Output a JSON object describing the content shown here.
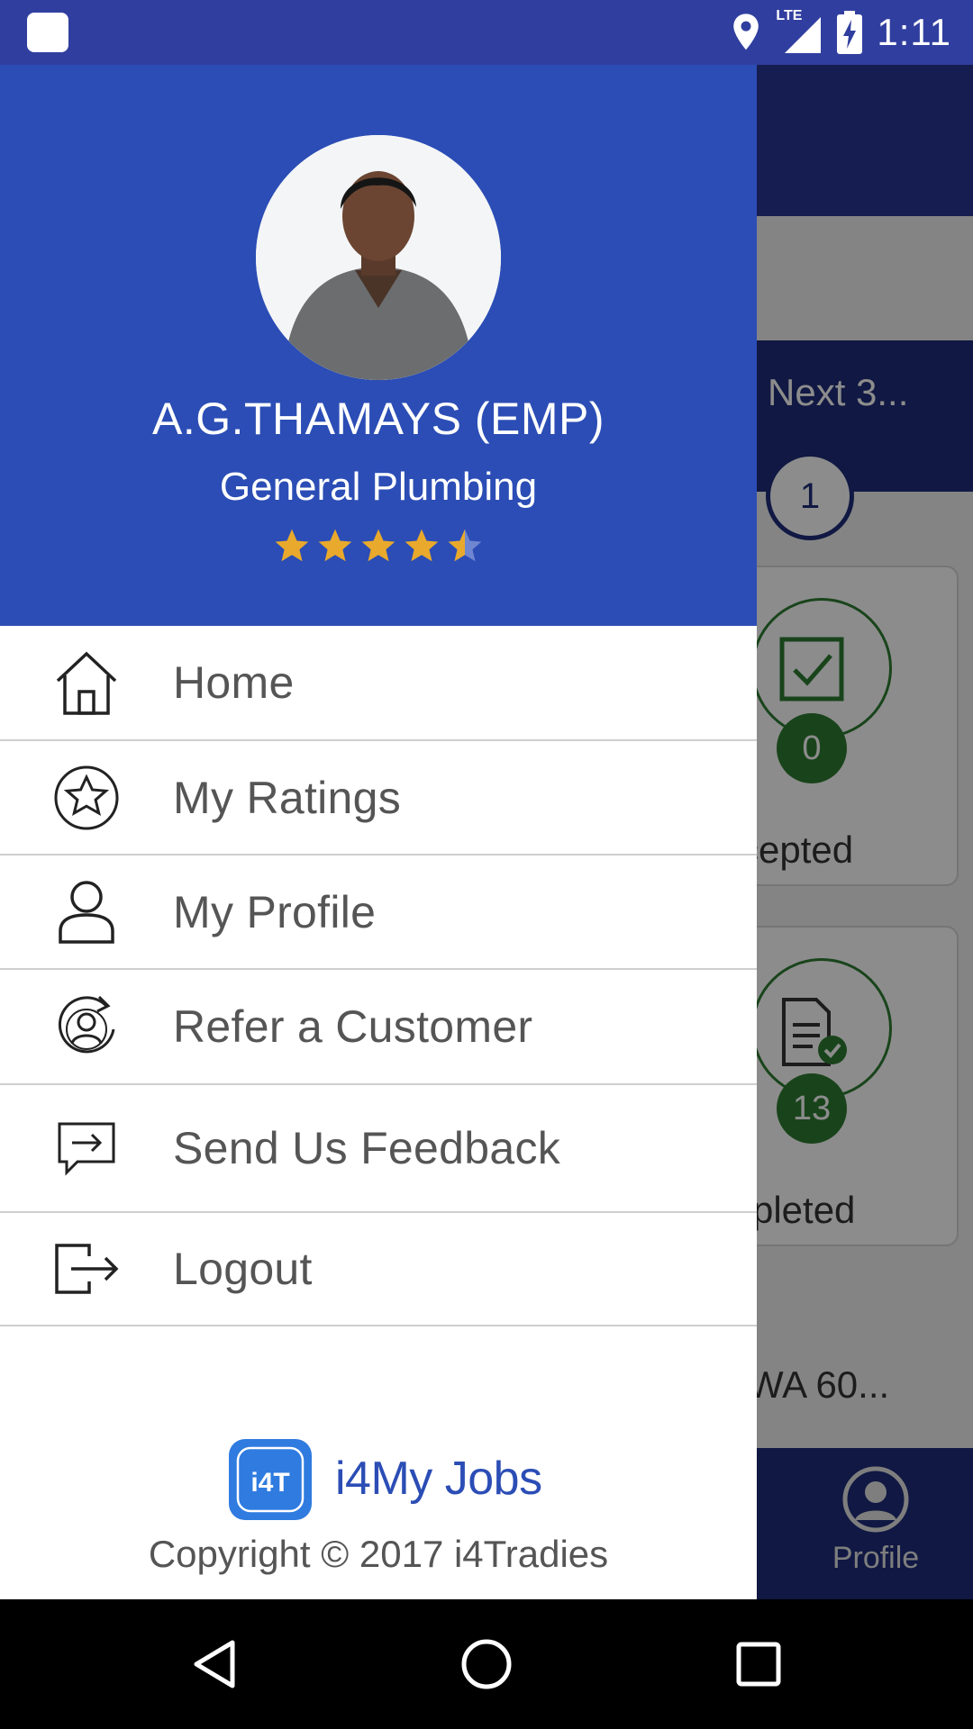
{
  "status_bar": {
    "time": "1:11",
    "network": "LTE"
  },
  "background_screen": {
    "band_text": "Next 3...",
    "step_number": "1",
    "cards": [
      {
        "count": "0",
        "label": "ccepted"
      },
      {
        "count": "13",
        "label": "mpleted"
      }
    ],
    "address_text": "WA 60...",
    "bottom_nav_profile_label": "Profile"
  },
  "drawer": {
    "header": {
      "name": "A.G.THAMAYS (EMP)",
      "trade": "General Plumbing",
      "rating_stars": 4.5,
      "colors": {
        "background": "#2B4DB5",
        "star": "#E9A92C"
      }
    },
    "menu": [
      {
        "label": "Home",
        "icon": "home-icon"
      },
      {
        "label": "My Ratings",
        "icon": "star-circle-icon"
      },
      {
        "label": "My Profile",
        "icon": "user-icon"
      },
      {
        "label": "Refer a Customer",
        "icon": "refer-icon"
      },
      {
        "label": "Send Us Feedback",
        "icon": "feedback-icon"
      },
      {
        "label": "Logout",
        "icon": "logout-icon"
      }
    ],
    "footer": {
      "brand": "i4My Jobs",
      "logo_text": "i4T",
      "copyright": "Copyright © 2017 i4Tradies"
    }
  }
}
